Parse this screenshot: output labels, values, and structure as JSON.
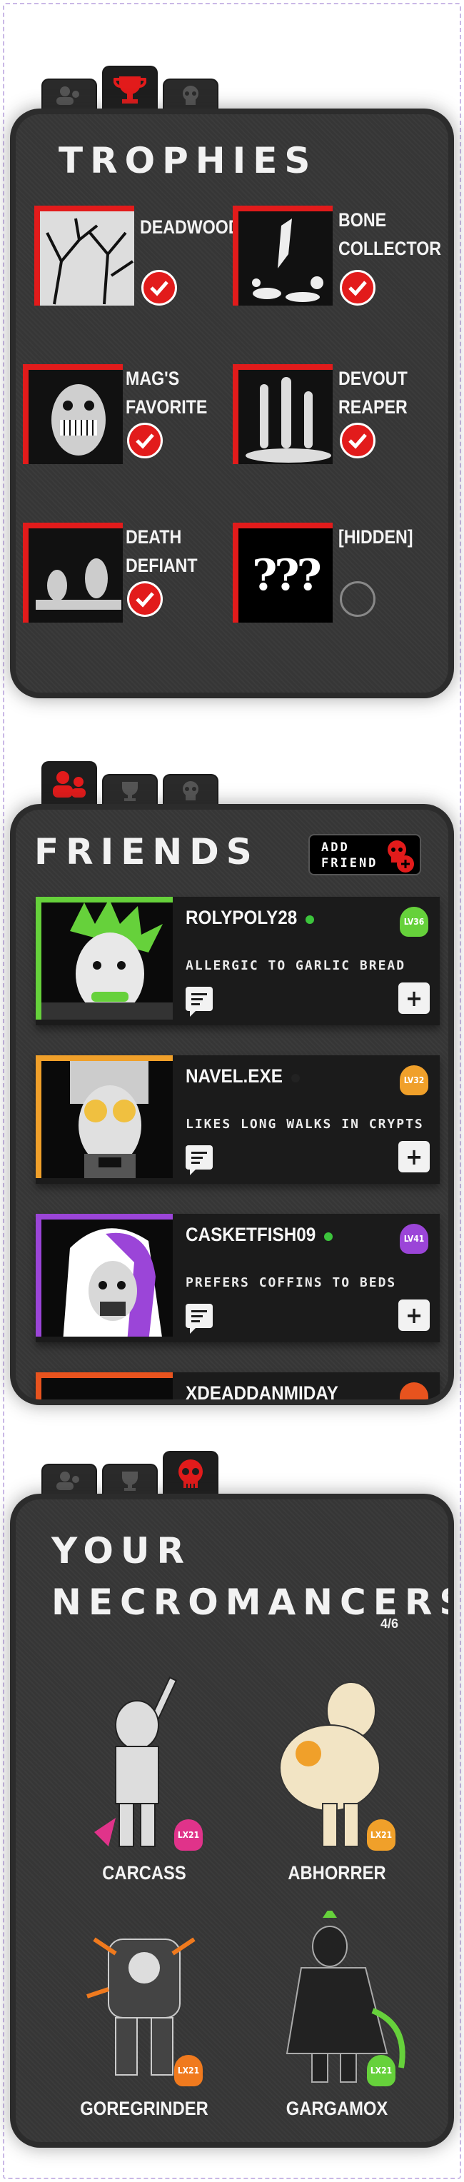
{
  "colors": {
    "accent": "#e21b1b",
    "panel": "#363636",
    "tab": "#2a2a2a"
  },
  "trophies_screen": {
    "tabs": [
      {
        "icon": "friends-icon",
        "active": false
      },
      {
        "icon": "trophy-icon",
        "active": true
      },
      {
        "icon": "skull-icon",
        "active": false
      }
    ],
    "title": "TROPHIES",
    "items": [
      {
        "name_lines": [
          "DEADWOOD"
        ],
        "unlocked": true
      },
      {
        "name_lines": [
          "BONE",
          "COLLECTOR"
        ],
        "unlocked": true
      },
      {
        "name_lines": [
          "MAG'S",
          "FAVORITE"
        ],
        "unlocked": true
      },
      {
        "name_lines": [
          "DEVOUT",
          "REAPER"
        ],
        "unlocked": true
      },
      {
        "name_lines": [
          "DEATH",
          "DEFIANT"
        ],
        "unlocked": true
      },
      {
        "name_lines": [
          "[HIDDEN]"
        ],
        "unlocked": false,
        "image_text": "???"
      }
    ]
  },
  "friends_screen": {
    "tabs": [
      {
        "icon": "friends-icon",
        "active": true
      },
      {
        "icon": "trophy-icon",
        "active": false
      },
      {
        "icon": "skull-icon",
        "active": false
      }
    ],
    "title": "FRIENDS",
    "add_friend": [
      "ADD",
      "FRIEND"
    ],
    "friends": [
      {
        "name": "ROLYPOLY28",
        "online": true,
        "level": "LV36",
        "desc": "ALLERGIC TO GARLIC BREAD",
        "color": "#66d13b"
      },
      {
        "name": "NAVEL.EXE",
        "online": false,
        "level": "LV32",
        "desc": "LIKES LONG WALKS IN CRYPTS",
        "color": "#f0a02a"
      },
      {
        "name": "CASKETFISH09",
        "online": true,
        "level": "LV41",
        "desc": "PREFERS COFFINS TO BEDS",
        "color": "#9b45d8"
      },
      {
        "name": "XDEADDANMIDAY",
        "online": false,
        "level": "",
        "desc": "",
        "color": "#e8531e"
      }
    ]
  },
  "necromancers_screen": {
    "tabs": [
      {
        "icon": "friends-icon",
        "active": false
      },
      {
        "icon": "trophy-icon",
        "active": false
      },
      {
        "icon": "skull-icon",
        "active": true
      }
    ],
    "title_lines": [
      "YOUR",
      "NECROMANCERS"
    ],
    "count": "4/6",
    "necromancers": [
      {
        "name": "CARCASS",
        "level": "LX21",
        "color": "#e0338a"
      },
      {
        "name": "ABHORRER",
        "level": "LX21",
        "color": "#f0a02a"
      },
      {
        "name": "GOREGRINDER",
        "level": "LX21",
        "color": "#f07a1e"
      },
      {
        "name": "GARGAMOX",
        "level": "LX21",
        "color": "#66d13b"
      }
    ]
  }
}
